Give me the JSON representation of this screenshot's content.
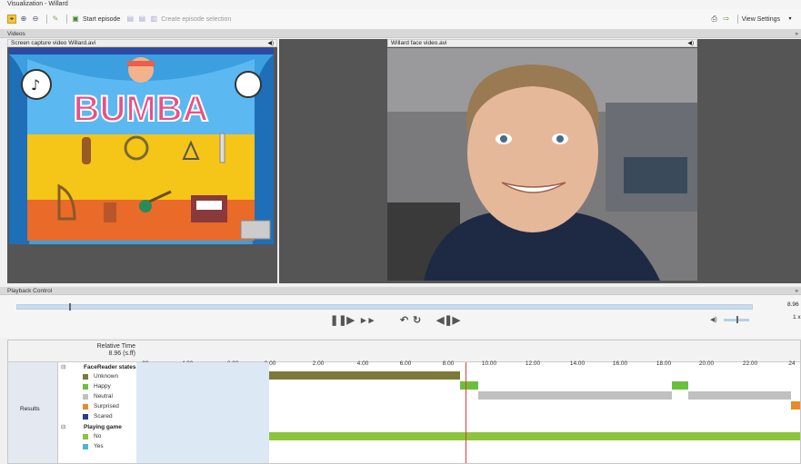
{
  "window": {
    "title": "Visualization - Willard"
  },
  "toolbar": {
    "start_episode_label": "Start episode",
    "create_selection_label": "Create episode selection",
    "view_settings_label": "View Settings"
  },
  "sections": {
    "videos": "Videos",
    "playback": "Playback Control"
  },
  "videos": {
    "left_title": "Screen capture video Willard.avi",
    "right_title": "Willard face video.avi",
    "game_logo": "BUMBA"
  },
  "playback": {
    "end_time": "8.96",
    "speed": "1 x"
  },
  "timeline": {
    "ruler_title": "Relative Time",
    "ruler_value": "8.96 (s.ff)",
    "ticks": [
      ".00",
      "-4.00",
      "-2.00",
      "0.00",
      "2.00",
      "4.00",
      "6.00",
      "8.00",
      "10.00",
      "12.00",
      "14.00",
      "16.00",
      "18.00",
      "20.00",
      "22.00",
      "24"
    ],
    "row_header": "Results",
    "groups": [
      {
        "title": "FaceReader states",
        "items": [
          {
            "label": "Unknown",
            "color": "#7b7a3a"
          },
          {
            "label": "Happy",
            "color": "#6cbf3e"
          },
          {
            "label": "Neutral",
            "color": "#c0c0c0"
          },
          {
            "label": "Surprised",
            "color": "#e88a2c"
          },
          {
            "label": "Scared",
            "color": "#2b3a8c"
          }
        ]
      },
      {
        "title": "Playing game",
        "items": [
          {
            "label": "No",
            "color": "#8cc43c"
          },
          {
            "label": "Yes",
            "color": "#4fb3d9"
          }
        ]
      }
    ],
    "colors": {
      "timeline_bg": "#dce8f4",
      "cursor": "#e03a3a"
    }
  }
}
